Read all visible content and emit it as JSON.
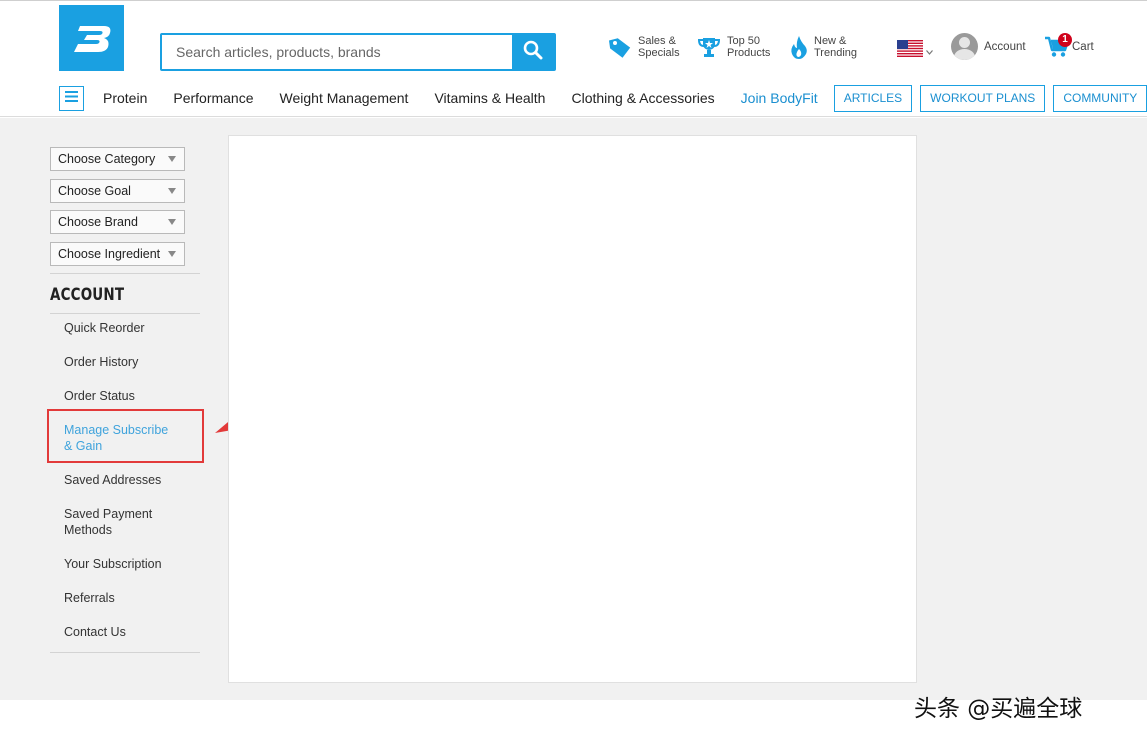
{
  "search": {
    "placeholder": "Search articles, products, brands"
  },
  "utility": {
    "sales": "Sales &\nSpecials",
    "top50": "Top 50\nProducts",
    "new": "New &\nTrending",
    "account": "Account",
    "cart": "Cart",
    "cart_count": "1"
  },
  "nav": {
    "links": [
      "Protein",
      "Performance",
      "Weight Management",
      "Vitamins & Health",
      "Clothing & Accessories"
    ],
    "join": "Join BodyFit",
    "pills": [
      "ARTICLES",
      "WORKOUT PLANS",
      "COMMUNITY"
    ]
  },
  "filters": [
    "Choose Category",
    "Choose Goal",
    "Choose Brand",
    "Choose Ingredient"
  ],
  "account": {
    "title": "ACCOUNT",
    "items": [
      "Quick Reorder",
      "Order History",
      "Order Status",
      "Manage Subscribe & Gain",
      "Saved Addresses",
      "Saved Payment Methods",
      "Your Subscription",
      "Referrals",
      "Contact Us"
    ],
    "active_index": 3
  },
  "colors": {
    "brand": "#1aa0e1",
    "highlight": "#e23a3a",
    "active_link": "#3fa3dc"
  },
  "watermark": "头条 @买遍全球"
}
